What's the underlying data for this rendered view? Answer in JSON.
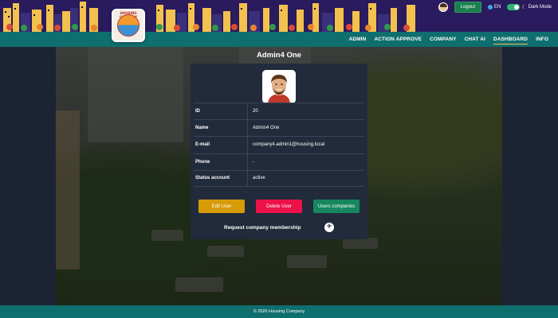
{
  "header": {
    "logo_text": "HOUSING COMPANY",
    "logout_label": "Logout",
    "language": "EN",
    "dark_mode_label": "Dark Mode"
  },
  "nav": {
    "items": [
      {
        "label": "ADMIN"
      },
      {
        "label": "ACTION APPROVE"
      },
      {
        "label": "COMPANY"
      },
      {
        "label": "CHAT AI"
      },
      {
        "label": "DASHBOARD"
      },
      {
        "label": "INFO"
      }
    ]
  },
  "profile": {
    "title": "Admin4 One",
    "fields": [
      {
        "key": "ID",
        "value": "20"
      },
      {
        "key": "Name",
        "value": "Admin4 One"
      },
      {
        "key": "E-mail",
        "value": "company4.admin1@housing.local"
      },
      {
        "key": "Phone",
        "value": "-"
      },
      {
        "key": "Status account",
        "value": "active"
      }
    ],
    "edit_label": "Edit User",
    "delete_label": "Delete User",
    "companies_label": "Users companies",
    "membership_label": "Request company membership",
    "plus_symbol": "+"
  },
  "footer": {
    "text": "© 2026 Housing Company"
  },
  "colors": {
    "header_bg": "#2a1a5e",
    "nav_bg": "#0f6e6e",
    "card_bg": "#222b3b",
    "edit": "#d79b07",
    "delete": "#ec1249",
    "companies": "#17875f",
    "logout": "#1a7f4e"
  }
}
